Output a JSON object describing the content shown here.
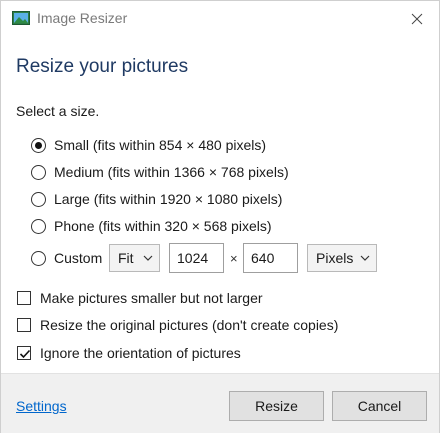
{
  "window": {
    "title": "Image Resizer"
  },
  "header": {
    "title": "Resize your pictures",
    "section_label": "Select a size."
  },
  "sizes": [
    {
      "label": "Small (fits within 854 × 480 pixels)",
      "checked": true
    },
    {
      "label": "Medium (fits within 1366 × 768 pixels)",
      "checked": false
    },
    {
      "label": "Large (fits within 1920 × 1080 pixels)",
      "checked": false
    },
    {
      "label": "Phone (fits within 320 × 568 pixels)",
      "checked": false
    },
    {
      "label": "Custom",
      "checked": false
    }
  ],
  "custom": {
    "mode_value": "Fit",
    "width_value": "1024",
    "times_symbol": "×",
    "height_value": "640",
    "unit_value": "Pixels"
  },
  "options": [
    {
      "label": "Make pictures smaller but not larger",
      "checked": false
    },
    {
      "label": "Resize the original pictures (don't create copies)",
      "checked": false
    },
    {
      "label": "Ignore the orientation of pictures",
      "checked": true
    }
  ],
  "footer": {
    "settings_link": "Settings",
    "resize_label": "Resize",
    "cancel_label": "Cancel"
  },
  "colors": {
    "header_title": "#1f3a63",
    "link": "#0066cc",
    "footer_bg": "#f0f0f0"
  }
}
